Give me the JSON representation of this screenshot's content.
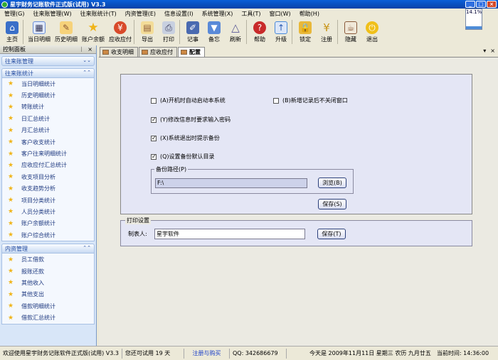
{
  "window": {
    "title": "星宇财务记账软件正式版(试用) V3.3"
  },
  "menu": [
    "管理(G)",
    "往来账管理(W)",
    "往来账统计(T)",
    "内资管理(E)",
    "信息设置(I)",
    "系统管理(X)",
    "工具(T)",
    "窗口(W)",
    "帮助(H)"
  ],
  "toolbar": [
    {
      "label": "主页",
      "icon": "home-icon",
      "color": "#3a6fc8"
    },
    {
      "label": "当日明细",
      "icon": "calendar-icon",
      "color": "#6a8fd8"
    },
    {
      "label": "历史明细",
      "icon": "history-icon",
      "color": "#d8902a"
    },
    {
      "label": "账户余额",
      "icon": "star-icon",
      "color": "#f0b418"
    },
    {
      "label": "应收应付",
      "icon": "money-icon",
      "color": "#d84a2a"
    },
    {
      "label": "导出",
      "icon": "export-icon",
      "color": "#e8c26a"
    },
    {
      "label": "打印",
      "icon": "printer-icon",
      "color": "#8a9ac0"
    },
    {
      "label": "记事",
      "icon": "note-icon",
      "color": "#4a6ab0"
    },
    {
      "label": "备忘",
      "icon": "memo-icon",
      "color": "#5a8ad8"
    },
    {
      "label": "刷新",
      "icon": "refresh-icon",
      "color": "#7a7aa8"
    },
    {
      "label": "帮助",
      "icon": "help-icon",
      "color": "#c82a2a"
    },
    {
      "label": "升级",
      "icon": "upgrade-icon",
      "color": "#4a8ad8"
    },
    {
      "label": "锁定",
      "icon": "lock-icon",
      "color": "#d8a42a"
    },
    {
      "label": "注册",
      "icon": "register-icon",
      "color": "#d8a42a"
    },
    {
      "label": "隐藏",
      "icon": "hide-icon",
      "color": "#8a5a3a"
    },
    {
      "label": "退出",
      "icon": "exit-icon",
      "color": "#e8b418"
    }
  ],
  "battery": {
    "text": "14.1%",
    "level": 0.141
  },
  "leftpanel": {
    "title": "控制面板",
    "group_collapsed": "往来账管理",
    "group1": {
      "title": "往来账统计",
      "items": [
        "当日明细统计",
        "历史明细统计",
        "转账统计",
        "日汇总统计",
        "月汇总统计",
        "客户收支统计",
        "客户往来明细统计",
        "应收应付汇总统计",
        "收支项目分析",
        "收支趋势分析",
        "项目分类统计",
        "人员分类统计",
        "账户余额统计",
        "账户综合统计"
      ]
    },
    "group2": {
      "title": "内资管理",
      "items": [
        "员工借款",
        "报账还款",
        "其他收入",
        "其他支出",
        "借款明细统计",
        "借款汇总统计"
      ]
    }
  },
  "tabs": [
    "收支明细",
    "应收应付",
    "配置"
  ],
  "config": {
    "opt_autostart": "(A)开机时自动启动本系统",
    "opt_keepopen": "(B)新增记录后不关闭窗口",
    "opt_password": "(Y)修改信息时要求输入密码",
    "opt_backup_prompt": "(X)系统退出时提示备份",
    "opt_backup_dir": "(Q)设置备份默认目录",
    "backup_path_label": "备份路径(P)",
    "backup_path_value": "F:\\",
    "browse_button": "浏览(B)",
    "save_button": "保存(S)"
  },
  "print": {
    "title": "打印设置",
    "maker_label": "制表人:",
    "maker_value": "星宇软件",
    "save_button": "保存(T)"
  },
  "statusbar": {
    "welcome": "欢迎使用星宇财务记账软件正式版(试用) V3.3",
    "trial": "您还可试用 19 天",
    "register": "注册与购买",
    "qq": "QQ: 342686679",
    "date": "今天是  2009年11月11日  星期三  农历  九月廿五",
    "time": "当前时间: 14:36:00"
  }
}
